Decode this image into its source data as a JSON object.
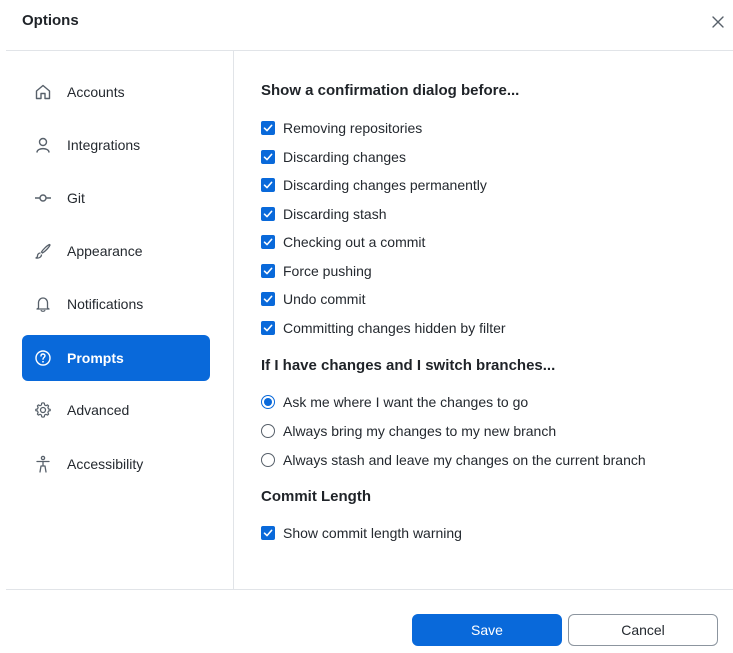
{
  "dialog": {
    "title": "Options"
  },
  "sidebar": {
    "items": [
      {
        "label": "Accounts",
        "icon": "home-icon",
        "active": false
      },
      {
        "label": "Integrations",
        "icon": "person-icon",
        "active": false
      },
      {
        "label": "Git",
        "icon": "git-commit-icon",
        "active": false
      },
      {
        "label": "Appearance",
        "icon": "paintbrush-icon",
        "active": false
      },
      {
        "label": "Notifications",
        "icon": "bell-icon",
        "active": false
      },
      {
        "label": "Prompts",
        "icon": "question-icon",
        "active": true
      },
      {
        "label": "Advanced",
        "icon": "gear-icon",
        "active": false
      },
      {
        "label": "Accessibility",
        "icon": "accessibility-icon",
        "active": false
      }
    ]
  },
  "confirmations": {
    "title": "Show a confirmation dialog before...",
    "options": [
      {
        "label": "Removing repositories",
        "checked": true
      },
      {
        "label": "Discarding changes",
        "checked": true
      },
      {
        "label": "Discarding changes permanently",
        "checked": true
      },
      {
        "label": "Discarding stash",
        "checked": true
      },
      {
        "label": "Checking out a commit",
        "checked": true
      },
      {
        "label": "Force pushing",
        "checked": true
      },
      {
        "label": "Undo commit",
        "checked": true
      },
      {
        "label": "Committing changes hidden by filter",
        "checked": true
      }
    ]
  },
  "switch_branches": {
    "title": "If I have changes and I switch branches...",
    "options": [
      {
        "label": "Ask me where I want the changes to go",
        "selected": true
      },
      {
        "label": "Always bring my changes to my new branch",
        "selected": false
      },
      {
        "label": "Always stash and leave my changes on the current branch",
        "selected": false
      }
    ]
  },
  "commit_length": {
    "title": "Commit Length",
    "options": [
      {
        "label": "Show commit length warning",
        "checked": true
      }
    ]
  },
  "footer": {
    "save_label": "Save",
    "cancel_label": "Cancel"
  },
  "colors": {
    "accent": "#0969da",
    "border": "#e1e4e8"
  }
}
